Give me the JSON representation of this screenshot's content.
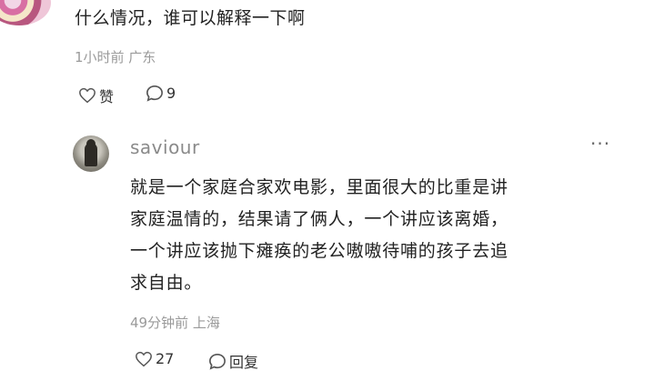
{
  "comment": {
    "text": "什么情况，谁可以解释一下啊",
    "meta": "1小时前 广东",
    "like_label": "赞",
    "reply_count": "9"
  },
  "reply": {
    "username": "saviour",
    "more_label": "···",
    "lines": [
      "就是一个家庭合家欢电影，里面很大的比重是讲",
      "家庭温情的，结果请了俩人，一个讲应该离婚，",
      "一个讲应该抛下瘫痪的老公嗷嗷待哺的孩子去追",
      "求自由。"
    ],
    "meta": "49分钟前 上海",
    "like_count": "27",
    "reply_label": "回复"
  }
}
